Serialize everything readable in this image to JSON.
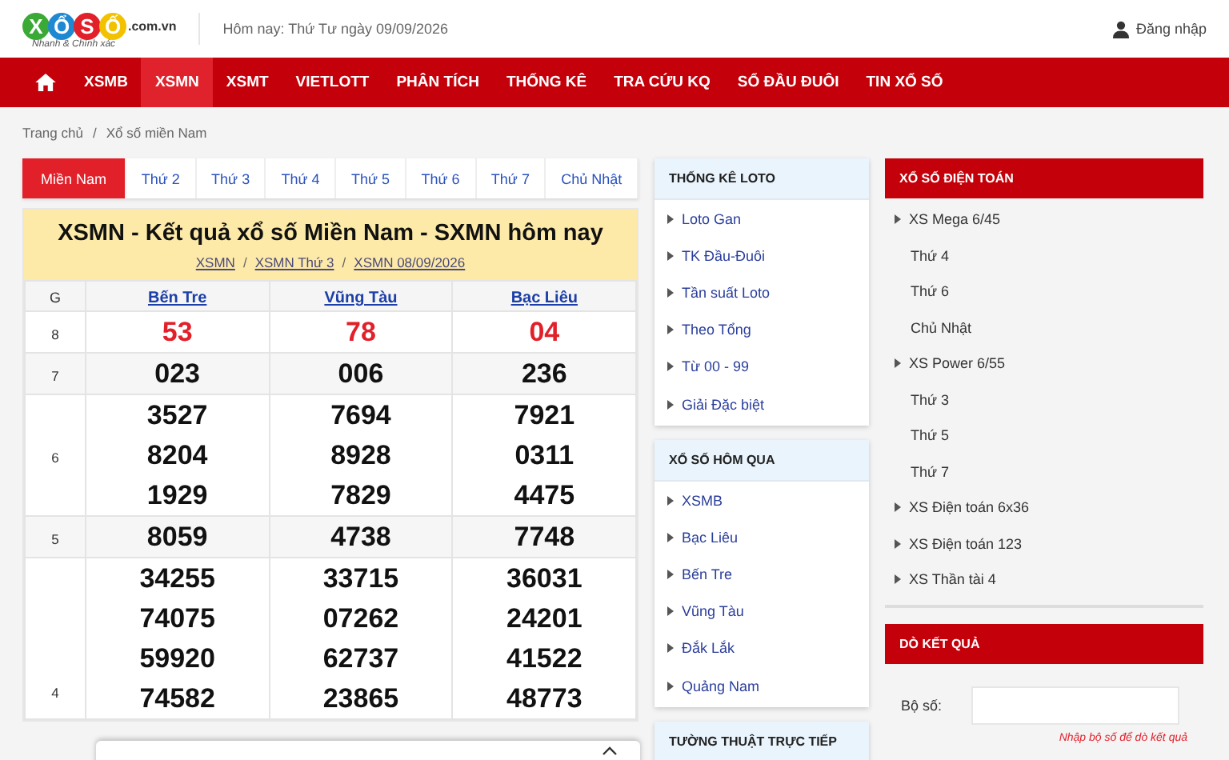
{
  "header": {
    "logo": {
      "letters": [
        {
          "char": "X",
          "color": "#3aa935"
        },
        {
          "char": "Ổ",
          "color": "#1e88d2"
        },
        {
          "char": "S",
          "color": "#e2202a"
        },
        {
          "char": "Ố",
          "color": "#f2c200"
        }
      ],
      "domain": ".com.vn",
      "tagline": "Nhanh & Chính xác"
    },
    "today": "Hôm nay: Thứ Tư ngày 09/09/2026",
    "login": "Đăng nhập"
  },
  "nav": [
    {
      "label": "XSMB",
      "selected": false
    },
    {
      "label": "XSMN",
      "selected": true
    },
    {
      "label": "XSMT",
      "selected": false
    },
    {
      "label": "VIETLOTT",
      "selected": false
    },
    {
      "label": "PHÂN TÍCH",
      "selected": false
    },
    {
      "label": "THỐNG KÊ",
      "selected": false
    },
    {
      "label": "TRA CỨU KQ",
      "selected": false
    },
    {
      "label": "SỔ ĐẦU ĐUÔI",
      "selected": false
    },
    {
      "label": "TIN XỔ SỐ",
      "selected": false
    }
  ],
  "breadcrumb": {
    "items": [
      "Trang chủ",
      "Xổ số miền Nam"
    ],
    "separator": "/"
  },
  "tabs": [
    {
      "label": "Miền Nam",
      "selected": true
    },
    {
      "label": "Thứ 2",
      "selected": false
    },
    {
      "label": "Thứ 3",
      "selected": false
    },
    {
      "label": "Thứ 4",
      "selected": false
    },
    {
      "label": "Thứ 5",
      "selected": false
    },
    {
      "label": "Thứ 6",
      "selected": false
    },
    {
      "label": "Thứ 7",
      "selected": false
    },
    {
      "label": "Chủ Nhật",
      "selected": false
    }
  ],
  "results": {
    "title": "XSMN - Kết quả xổ số Miền Nam - SXMN hôm nay",
    "links": [
      "XSMN",
      "XSMN Thứ 3",
      "XSMN 08/09/2026"
    ],
    "links_separator": "/",
    "columns": [
      "G",
      "Bến Tre",
      "Vũng Tàu",
      "Bạc Liêu"
    ],
    "rows": [
      {
        "highlight": true,
        "cells": [
          [
            "8"
          ],
          [
            "53"
          ],
          [
            "78"
          ],
          [
            "04"
          ]
        ]
      },
      {
        "highlight": false,
        "cells": [
          [
            "7"
          ],
          [
            "023"
          ],
          [
            "006"
          ],
          [
            "236"
          ]
        ]
      },
      {
        "highlight": false,
        "cells": [
          [
            "6"
          ],
          [
            "3527",
            "8204",
            "1929"
          ],
          [
            "7694",
            "8928",
            "7829"
          ],
          [
            "7921",
            "0311",
            "4475"
          ]
        ]
      },
      {
        "highlight": false,
        "cells": [
          [
            "5"
          ],
          [
            "8059"
          ],
          [
            "4738"
          ],
          [
            "7748"
          ]
        ]
      },
      {
        "highlight": false,
        "cells": [
          [
            "4"
          ],
          [
            "34255",
            "74075",
            "59920",
            "74582"
          ],
          [
            "33715",
            "07262",
            "62737",
            "23865"
          ],
          [
            "36031",
            "24201",
            "41522",
            "48773"
          ]
        ]
      }
    ]
  },
  "middle_boxes": [
    {
      "title": "THỐNG KÊ LOTO",
      "items": [
        "Loto Gan",
        "TK Đầu-Đuôi",
        "Tần suất Loto",
        "Theo Tổng",
        "Từ 00 - 99",
        "Giải Đặc biệt"
      ]
    },
    {
      "title": "XỔ SỐ HÔM QUA",
      "items": [
        "XSMB",
        "Bạc Liêu",
        "Bến Tre",
        "Vũng Tàu",
        "Đắk Lắk",
        "Quảng Nam"
      ]
    },
    {
      "title": "TƯỜNG THUẬT TRỰC TIẾP"
    }
  ],
  "dien_toan": {
    "title": "XỔ SỐ ĐIỆN TOÁN",
    "items": [
      {
        "kind": "group",
        "label": "XS Mega 6/45"
      },
      {
        "kind": "sub",
        "label": "Thứ 4"
      },
      {
        "kind": "sub",
        "label": "Thứ 6"
      },
      {
        "kind": "sub",
        "label": "Chủ Nhật"
      },
      {
        "kind": "group",
        "label": "XS Power 6/55"
      },
      {
        "kind": "sub",
        "label": "Thứ 3"
      },
      {
        "kind": "sub",
        "label": "Thứ 5"
      },
      {
        "kind": "sub",
        "label": "Thứ 7"
      },
      {
        "kind": "group",
        "label": "XS Điện toán 6x36"
      },
      {
        "kind": "group",
        "label": "XS Điện toán 123"
      },
      {
        "kind": "group",
        "label": "XS Thần tài 4"
      }
    ]
  },
  "do_ket_qua": {
    "title": "DÒ KẾT QUẢ",
    "label": "Bộ số:",
    "hint": "Nhập bộ số để dò kết quả"
  }
}
